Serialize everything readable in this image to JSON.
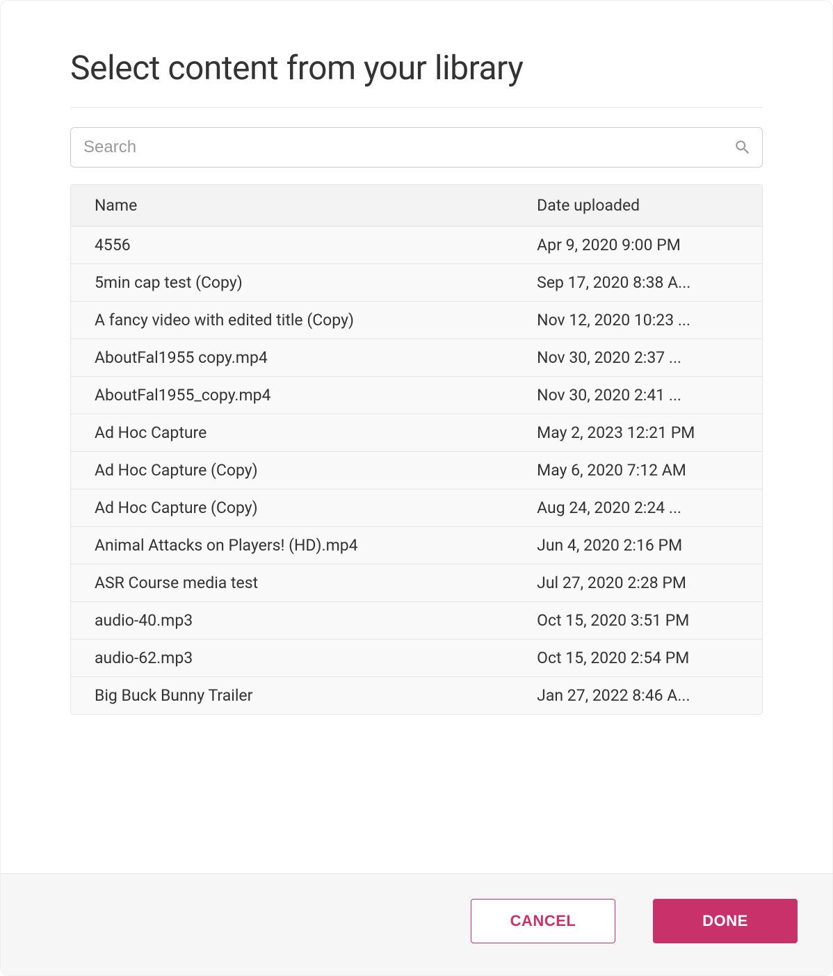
{
  "modal": {
    "title": "Select content from your library"
  },
  "search": {
    "placeholder": "Search",
    "value": ""
  },
  "table": {
    "headers": {
      "name": "Name",
      "date": "Date uploaded"
    },
    "rows": [
      {
        "name": "4556",
        "date": "Apr 9, 2020 9:00 PM"
      },
      {
        "name": "5min cap test (Copy)",
        "date": "Sep 17, 2020 8:38 A..."
      },
      {
        "name": "A fancy video with edited title (Copy)",
        "date": "Nov 12, 2020 10:23 ..."
      },
      {
        "name": "AboutFal1955 copy.mp4",
        "date": "Nov 30, 2020 2:37 ..."
      },
      {
        "name": "AboutFal1955_copy.mp4",
        "date": "Nov 30, 2020 2:41 ..."
      },
      {
        "name": "Ad Hoc Capture",
        "date": "May 2, 2023 12:21 PM"
      },
      {
        "name": "Ad Hoc Capture (Copy)",
        "date": "May 6, 2020 7:12 AM"
      },
      {
        "name": "Ad Hoc Capture (Copy)",
        "date": "Aug 24, 2020 2:24 ..."
      },
      {
        "name": "Animal Attacks on Players! (HD).mp4",
        "date": "Jun 4, 2020 2:16 PM"
      },
      {
        "name": "ASR Course media test",
        "date": "Jul 27, 2020 2:28 PM"
      },
      {
        "name": "audio-40.mp3",
        "date": "Oct 15, 2020 3:51 PM"
      },
      {
        "name": "audio-62.mp3",
        "date": "Oct 15, 2020 2:54 PM"
      },
      {
        "name": "Big Buck Bunny Trailer",
        "date": "Jan 27, 2022 8:46 A..."
      }
    ]
  },
  "footer": {
    "cancel_label": "CANCEL",
    "done_label": "DONE"
  },
  "colors": {
    "accent": "#c9316a"
  }
}
